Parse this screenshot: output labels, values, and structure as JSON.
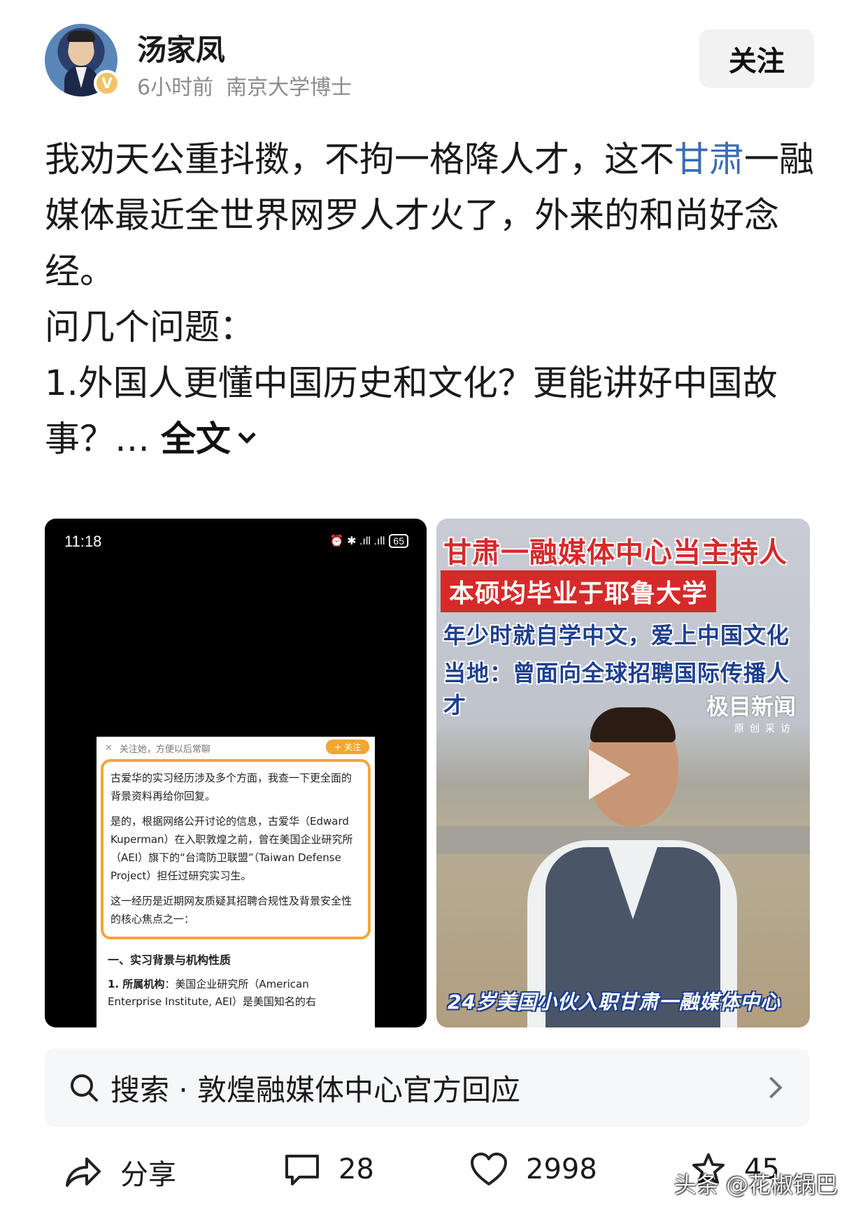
{
  "author": {
    "name": "汤家凤",
    "time": "6小时前",
    "title": "南京大学博士",
    "badge": "V",
    "follow_label": "关注"
  },
  "post": {
    "line1_a": "我劝天公重抖擞，不拘一格降人才，这不",
    "link_text": "甘肃",
    "line1_b": "一融媒体最近全世界网罗人才火了，外来的和尚好念经。",
    "line2": "问几个问题：",
    "line3": "1.外国人更懂中国历史和文化？更能讲好中国故事？…",
    "more_label": "全文"
  },
  "screenshot_left": {
    "time": "11:18",
    "status": "⏰ ✱ .ıll .ıll",
    "battery": "65",
    "card_top": "关注她，方便以后常聊",
    "card_follow": "+ 关注",
    "para1": "古爱华的实习经历涉及多个方面，我查一下更全面的背景资料再给你回复。",
    "para2": "是的，根据网络公开讨论的信息，古爱华（Edward Kuperman）在入职敦煌之前，曾在美国企业研究所（AEI）旗下的“台湾防卫联盟”（Taiwan Defense Project）担任过研究实习生。",
    "para3": "这一经历是近期网友质疑其招聘合规性及背景安全性的核心焦点之一：",
    "heading": "一、实习背景与机构性质",
    "item_label": "1. 所属机构",
    "item_text": "：美国企业研究所（American Enterprise Institute, AEI）是美国知名的右"
  },
  "screenshot_right": {
    "caption1": "甘肃一融媒体中心当主持人",
    "caption2": "本硕均毕业于耶鲁大学",
    "caption3": "年少时就自学中文，爱上中国文化",
    "caption4": "当地：曾面向全球招聘国际传播人才",
    "watermark_main": "极目新闻",
    "watermark_sub": "原创采访",
    "caption5": "24岁美国小伙入职甘肃一融媒体中心"
  },
  "search": {
    "text": "搜索 · 敦煌融媒体中心官方回应"
  },
  "actions": {
    "share_label": "分享",
    "comment_count": "28",
    "like_count": "2998",
    "fav_count": "45"
  },
  "watermark": "头条 @花椒锅巴",
  "colors": {
    "link": "#3a6db5",
    "badge": "#f0c36a",
    "caption_red": "#d62a2a",
    "caption_blue": "#1d3f8f"
  }
}
